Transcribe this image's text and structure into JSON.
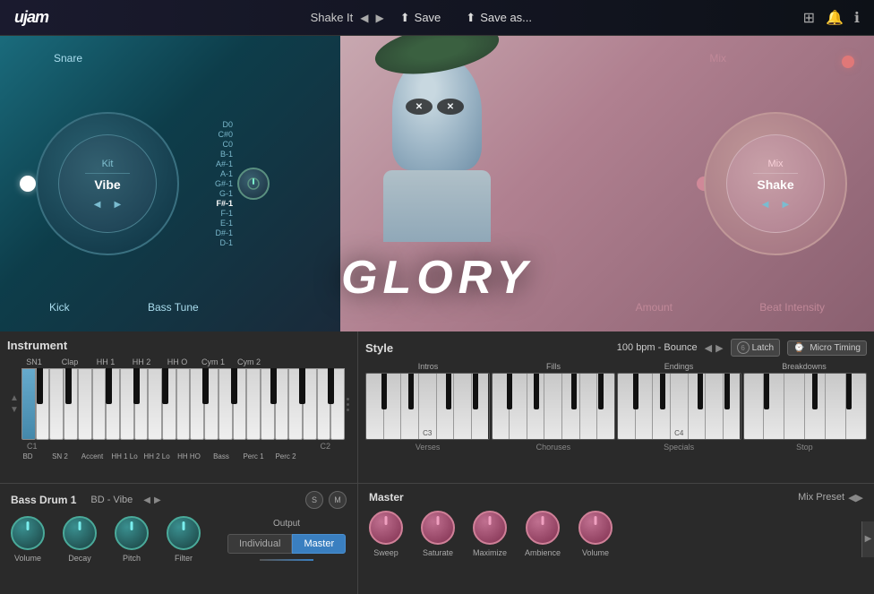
{
  "topbar": {
    "logo": "ujam",
    "preset_name": "Shake It",
    "save_label": "Save",
    "save_as_label": "Save as...",
    "nav_prev": "◀",
    "nav_next": "▶"
  },
  "hero": {
    "glory_text": "GLORY",
    "left": {
      "snare_label": "Snare",
      "kick_label": "Kick",
      "bass_tune_label": "Bass Tune",
      "kit_label": "Kit",
      "vibe_label": "Vibe",
      "arrow_left": "◀",
      "arrow_right": "▶",
      "notes": [
        "D0",
        "C#0",
        "C0",
        "B-1",
        "A#-1",
        "A-1",
        "G#-1",
        "G-1",
        "F#-1",
        "F-1",
        "E-1",
        "D#-1",
        "D-1"
      ]
    },
    "right": {
      "mix_label": "Mix",
      "shake_label": "Shake",
      "amount_label": "Amount",
      "beat_intensity_label": "Beat Intensity",
      "arrow_left": "◀",
      "arrow_right": "▶"
    }
  },
  "instrument": {
    "title": "Instrument",
    "top_labels": [
      "SN1",
      "Clap",
      "HH 1",
      "HH 2",
      "HH O",
      "Cym 1",
      "Cym 2"
    ],
    "bottom_labels": [
      "BD",
      "SN 2",
      "Accent",
      "HH 1 Lo",
      "HH 2 Lo",
      "HH HO",
      "Bass",
      "Perc 1",
      "Perc 2"
    ],
    "note_c1": "C1",
    "note_c2": "C2"
  },
  "style": {
    "title": "Style",
    "bpm": "100 bpm - Bounce",
    "nav_prev": "◀",
    "nav_next": "▶",
    "latch_label": "Latch",
    "latch_number": "6",
    "micro_timing_label": "Micro Timing",
    "section_labels": [
      "Intros",
      "Fills",
      "Endings",
      "Breakdowns"
    ],
    "bottom_labels": [
      "Verses",
      "Choruses",
      "Specials",
      "Stop"
    ],
    "note_c3": "C3",
    "note_c4": "C4"
  },
  "bass_drum": {
    "title": "Bass Drum 1",
    "preset": "BD - Vibe",
    "nav_prev": "◀",
    "nav_next": "▶",
    "s_label": "S",
    "m_label": "M",
    "knobs": [
      {
        "label": "Volume"
      },
      {
        "label": "Decay"
      },
      {
        "label": "Pitch"
      },
      {
        "label": "Filter"
      }
    ],
    "output_label": "Output",
    "individual_label": "Individual",
    "master_label": "Master"
  },
  "master": {
    "title": "Master",
    "mix_preset_label": "Mix Preset",
    "nav_prev": "◀",
    "nav_next": "▶",
    "knobs": [
      {
        "label": "Sweep"
      },
      {
        "label": "Saturate"
      },
      {
        "label": "Maximize"
      },
      {
        "label": "Ambience"
      },
      {
        "label": "Volume"
      }
    ]
  }
}
